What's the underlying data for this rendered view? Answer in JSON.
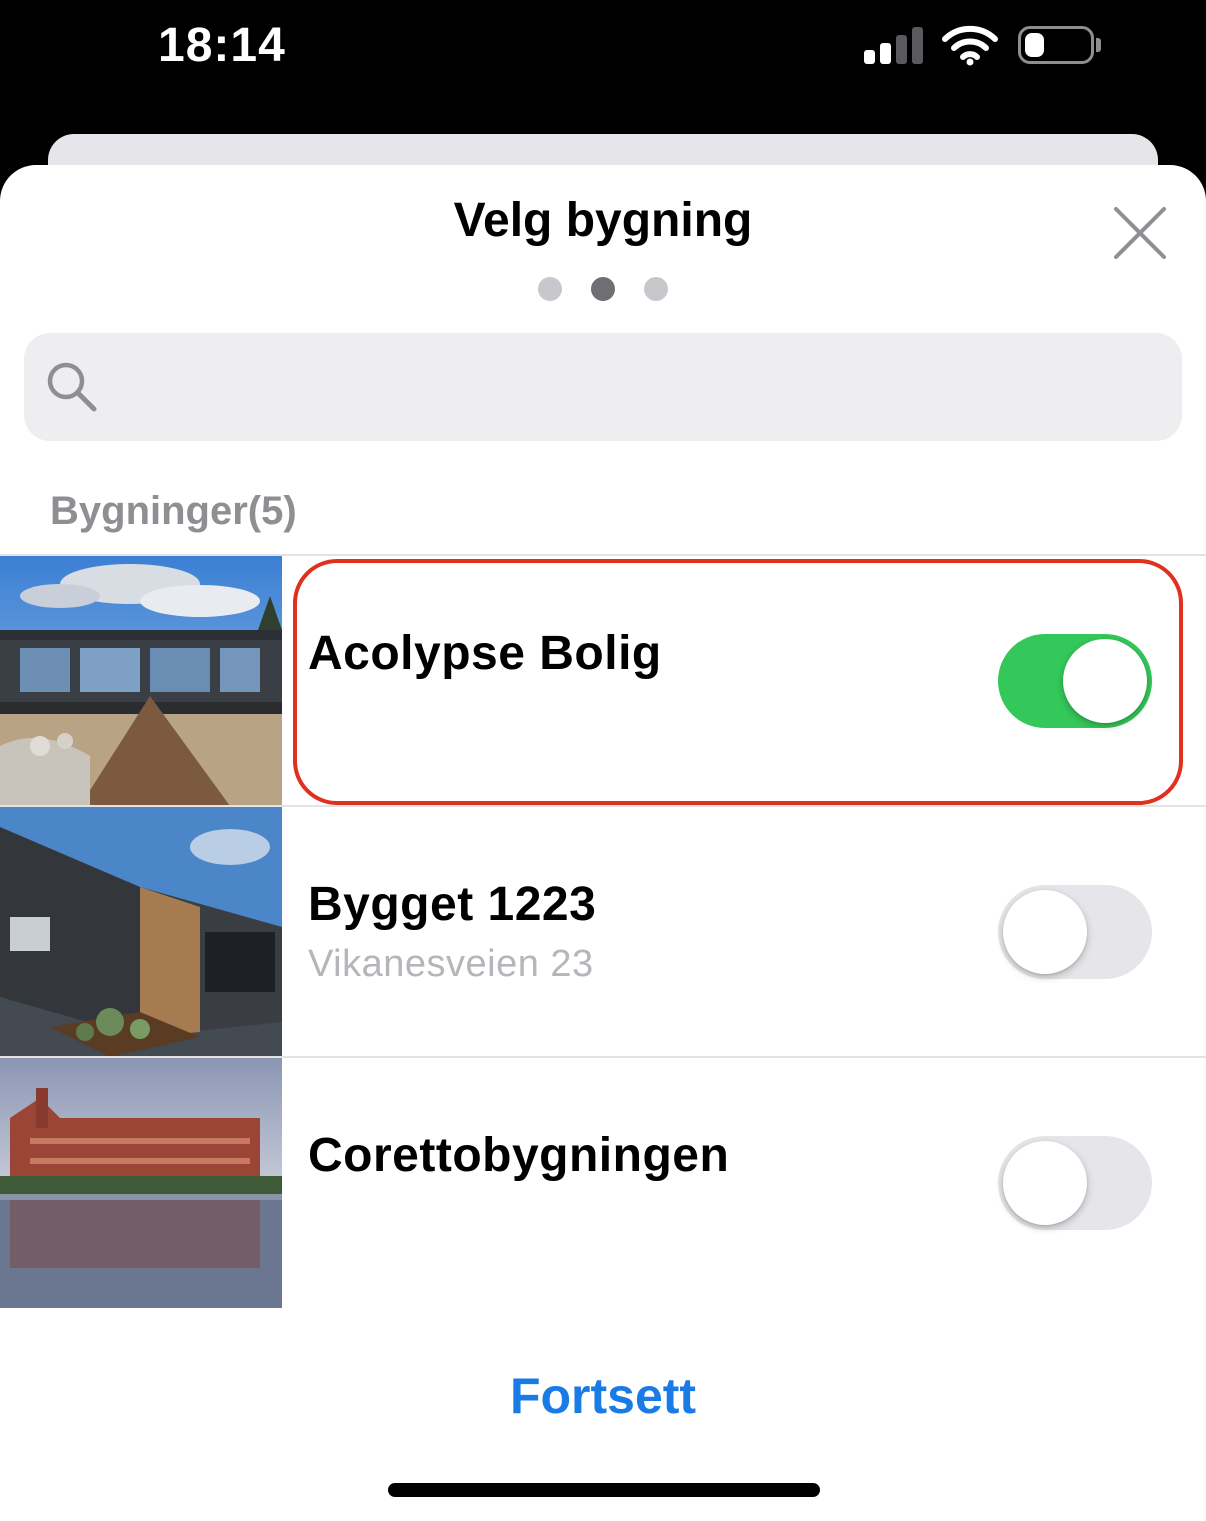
{
  "status_bar": {
    "time": "18:14",
    "signal_bars_filled": 2,
    "signal_bars_total": 4,
    "battery_level": 0.3
  },
  "sheet": {
    "title": "Velg bygning",
    "close_icon": "close-x-icon",
    "page_indicator": {
      "count": 3,
      "active_index": 1
    }
  },
  "search": {
    "value": "",
    "placeholder": "",
    "icon": "magnifying-glass-icon"
  },
  "buildings": {
    "header": "Bygninger(5)",
    "items": [
      {
        "name": "Acolypse Bolig",
        "address": "",
        "selected": true,
        "highlighted": true
      },
      {
        "name": "Bygget 1223",
        "address": "Vikanesveien 23",
        "selected": false,
        "highlighted": false
      },
      {
        "name": "Corettobygningen",
        "address": "",
        "selected": false,
        "highlighted": false
      }
    ]
  },
  "footer": {
    "continue_label": "Fortsett"
  },
  "colors": {
    "accent_blue": "#1a7ae6",
    "toggle_on_green": "#34c759",
    "highlight_red": "#e0301e",
    "secondary_text": "#8e8e93"
  }
}
